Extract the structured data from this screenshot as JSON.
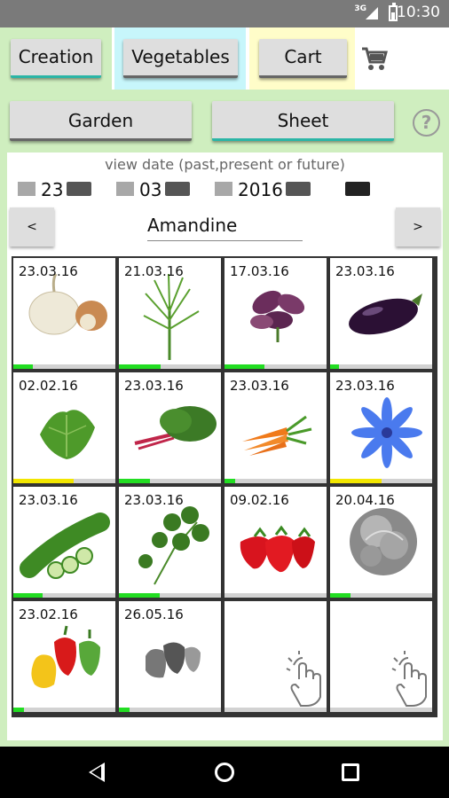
{
  "status": {
    "network": "3G",
    "time": "10:30"
  },
  "tabs": {
    "creation": "Creation",
    "vegetables": "Vegetables",
    "cart": "Cart"
  },
  "subtabs": {
    "garden": "Garden",
    "sheet": "Sheet",
    "help": "?"
  },
  "view_date": {
    "label": "view date (past,present or future)",
    "day": "23",
    "month": "03",
    "year": "2016"
  },
  "navigator": {
    "prev": "<",
    "next": ">",
    "name": "Amandine"
  },
  "icons": {
    "cart": "cart-icon",
    "help": "help-icon",
    "tap": "tap-hand-icon",
    "back": "back-icon",
    "home": "home-icon",
    "recents": "recents-icon"
  },
  "colors": {
    "green": "#22dd22",
    "yellow": "#f2e600",
    "tab_creation": "#cfeebf",
    "tab_vegetables": "#c7f6fb",
    "tab_cart": "#fffdc9"
  },
  "cells": [
    {
      "date": "23.03.16",
      "veg": "garlic",
      "progress": 0.19,
      "color": "green"
    },
    {
      "date": "21.03.16",
      "veg": "dill",
      "progress": 0.41,
      "color": "green"
    },
    {
      "date": "17.03.16",
      "veg": "basil-purple",
      "progress": 0.39,
      "color": "green"
    },
    {
      "date": "23.03.16",
      "veg": "eggplant",
      "progress": 0.09,
      "color": "green"
    },
    {
      "date": "02.02.16",
      "veg": "spinach",
      "progress": 0.59,
      "color": "yellow"
    },
    {
      "date": "23.03.16",
      "veg": "chard",
      "progress": 0.3,
      "color": "green"
    },
    {
      "date": "23.03.16",
      "veg": "carrot",
      "progress": 0.1,
      "color": "green"
    },
    {
      "date": "23.03.16",
      "veg": "chicory-flower",
      "progress": 0.5,
      "color": "yellow"
    },
    {
      "date": "23.03.16",
      "veg": "cucumber",
      "progress": 0.29,
      "color": "green"
    },
    {
      "date": "23.03.16",
      "veg": "coriander",
      "progress": 0.4,
      "color": "green"
    },
    {
      "date": "09.02.16",
      "veg": "strawberry",
      "progress": 0.0,
      "color": "green"
    },
    {
      "date": "20.04.16",
      "veg": "lettuce-gray",
      "progress": 0.2,
      "color": "green"
    },
    {
      "date": "23.02.16",
      "veg": "pepper",
      "progress": 0.1,
      "color": "green"
    },
    {
      "date": "26.05.16",
      "veg": "pepper-gray",
      "progress": 0.1,
      "color": "green"
    },
    {
      "date": "",
      "veg": "empty",
      "progress": 0.0,
      "color": "green"
    },
    {
      "date": "",
      "veg": "empty",
      "progress": 0.0,
      "color": "green"
    }
  ]
}
